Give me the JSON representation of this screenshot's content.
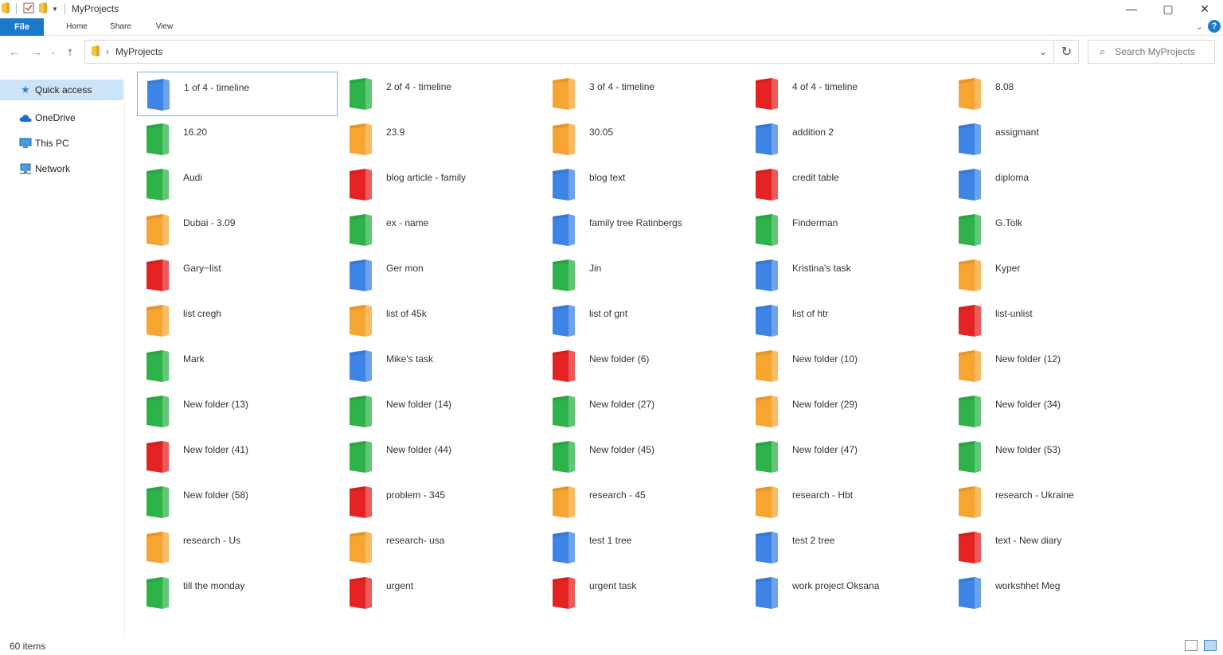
{
  "window": {
    "title": "MyProjects",
    "controls": {
      "minimize": "—",
      "maximize": "▢",
      "close": "✕"
    }
  },
  "ribbon": {
    "file": "File",
    "tabs": [
      "Home",
      "Share",
      "View"
    ],
    "help": "?"
  },
  "address": {
    "path": "MyProjects",
    "search_placeholder": "Search MyProjects"
  },
  "sidebar": {
    "items": [
      {
        "label": "Quick access",
        "icon": "star-icon"
      },
      {
        "label": "OneDrive",
        "icon": "cloud-icon"
      },
      {
        "label": "This PC",
        "icon": "computer-icon"
      },
      {
        "label": "Network",
        "icon": "network-icon"
      }
    ]
  },
  "colors": {
    "blue": "#3d84e6",
    "green": "#2eb24a",
    "orange": "#f7a531",
    "red": "#e52323",
    "accent": "#1979ca"
  },
  "folders": [
    {
      "name": "1 of 4 - timeline",
      "color": "blue",
      "selected": true
    },
    {
      "name": "2 of 4 - timeline",
      "color": "green"
    },
    {
      "name": "3 of 4 - timeline",
      "color": "orange"
    },
    {
      "name": "4 of 4 - timeline",
      "color": "red"
    },
    {
      "name": "8.08",
      "color": "orange"
    },
    {
      "name": "16.20",
      "color": "green"
    },
    {
      "name": "23.9",
      "color": "orange"
    },
    {
      "name": "30.05",
      "color": "orange"
    },
    {
      "name": "addition 2",
      "color": "blue"
    },
    {
      "name": "assigmant",
      "color": "blue"
    },
    {
      "name": "Audi",
      "color": "green"
    },
    {
      "name": "blog article - family",
      "color": "red"
    },
    {
      "name": "blog text",
      "color": "blue"
    },
    {
      "name": "credit table",
      "color": "red"
    },
    {
      "name": "diploma",
      "color": "blue"
    },
    {
      "name": "Dubai - 3.09",
      "color": "orange"
    },
    {
      "name": "ex - name",
      "color": "green"
    },
    {
      "name": "family tree Ratinbergs",
      "color": "blue"
    },
    {
      "name": "Finderman",
      "color": "green"
    },
    {
      "name": "G.Tolk",
      "color": "green"
    },
    {
      "name": "Gary~list",
      "color": "red"
    },
    {
      "name": "Ger mon",
      "color": "blue"
    },
    {
      "name": "Jin",
      "color": "green"
    },
    {
      "name": "Kristina's task",
      "color": "blue"
    },
    {
      "name": "Kyper",
      "color": "orange"
    },
    {
      "name": "list cregh",
      "color": "orange"
    },
    {
      "name": "list of 45k",
      "color": "orange"
    },
    {
      "name": "list of gnt",
      "color": "blue"
    },
    {
      "name": "list of htr",
      "color": "blue"
    },
    {
      "name": "list-unlist",
      "color": "red"
    },
    {
      "name": "Mark",
      "color": "green"
    },
    {
      "name": "Mike's task",
      "color": "blue"
    },
    {
      "name": "New folder (6)",
      "color": "red"
    },
    {
      "name": "New folder (10)",
      "color": "orange"
    },
    {
      "name": "New folder (12)",
      "color": "orange"
    },
    {
      "name": "New folder (13)",
      "color": "green"
    },
    {
      "name": "New folder (14)",
      "color": "green"
    },
    {
      "name": "New folder (27)",
      "color": "green"
    },
    {
      "name": "New folder (29)",
      "color": "orange"
    },
    {
      "name": "New folder (34)",
      "color": "green"
    },
    {
      "name": "New folder (41)",
      "color": "red"
    },
    {
      "name": "New folder (44)",
      "color": "green"
    },
    {
      "name": "New folder (45)",
      "color": "green"
    },
    {
      "name": "New folder (47)",
      "color": "green"
    },
    {
      "name": "New folder (53)",
      "color": "green"
    },
    {
      "name": "New folder (58)",
      "color": "green"
    },
    {
      "name": "problem - 345",
      "color": "red"
    },
    {
      "name": "research - 45",
      "color": "orange"
    },
    {
      "name": "research - Hbt",
      "color": "orange"
    },
    {
      "name": "research - Ukraine",
      "color": "orange"
    },
    {
      "name": "research - Us",
      "color": "orange"
    },
    {
      "name": "research- usa",
      "color": "orange"
    },
    {
      "name": "test 1 tree",
      "color": "blue"
    },
    {
      "name": "test 2 tree",
      "color": "blue"
    },
    {
      "name": "text - New diary",
      "color": "red"
    },
    {
      "name": "till the monday",
      "color": "green"
    },
    {
      "name": "urgent",
      "color": "red"
    },
    {
      "name": "urgent task",
      "color": "red"
    },
    {
      "name": "work project Oksana",
      "color": "blue"
    },
    {
      "name": "workshhet Meg",
      "color": "blue"
    }
  ],
  "status": {
    "item_count": "60 items"
  }
}
